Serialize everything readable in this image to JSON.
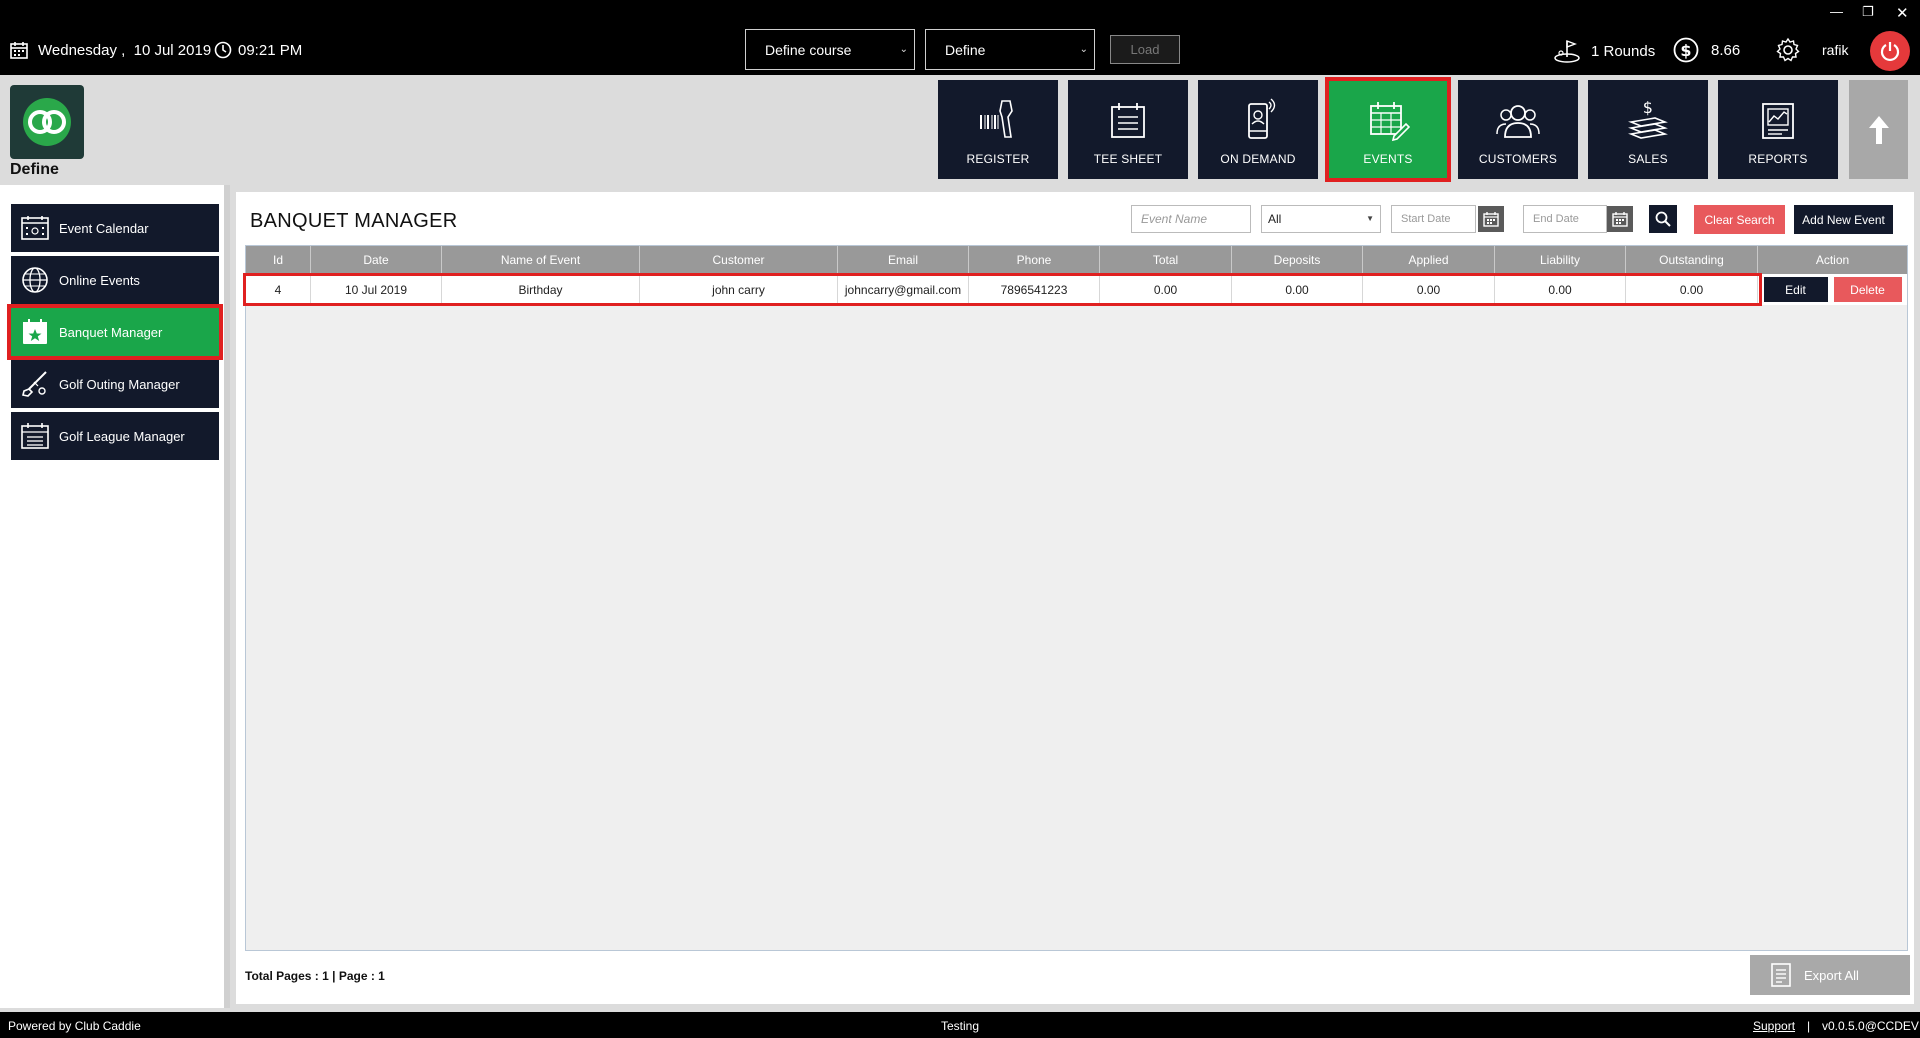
{
  "topbar": {
    "date": "Wednesday ,  10 Jul 2019",
    "time": "09:21 PM",
    "course_select": "Define course",
    "define_select": "Define",
    "load_label": "Load",
    "rounds": "1 Rounds",
    "balance": "8.66",
    "user": "rafik"
  },
  "header": {
    "course_name": "Define",
    "nav": [
      {
        "label": "REGISTER",
        "icon": "barcode-scanner-icon"
      },
      {
        "label": "TEE SHEET",
        "icon": "sheet-icon"
      },
      {
        "label": "ON DEMAND",
        "icon": "mobile-icon"
      },
      {
        "label": "EVENTS",
        "icon": "calendar-edit-icon",
        "active": true
      },
      {
        "label": "CUSTOMERS",
        "icon": "users-icon"
      },
      {
        "label": "SALES",
        "icon": "money-icon"
      },
      {
        "label": "REPORTS",
        "icon": "report-icon"
      }
    ]
  },
  "sidebar": {
    "items": [
      {
        "label": "Event Calendar",
        "icon": "calendar-icon"
      },
      {
        "label": "Online Events",
        "icon": "globe-icon"
      },
      {
        "label": "Banquet Manager",
        "icon": "star-calendar-icon",
        "active": true
      },
      {
        "label": "Golf Outing Manager",
        "icon": "golf-club-icon"
      },
      {
        "label": "Golf League Manager",
        "icon": "calendar-list-icon"
      }
    ]
  },
  "main": {
    "title": "BANQUET MANAGER",
    "filters": {
      "event_name_placeholder": "Event Name",
      "status_value": "All",
      "start_date_placeholder": "Start Date",
      "end_date_placeholder": "End Date",
      "clear_label": "Clear Search",
      "add_label": "Add New Event"
    },
    "table": {
      "columns": [
        "Id",
        "Date",
        "Name of Event",
        "Customer",
        "Email",
        "Phone",
        "Total",
        "Deposits",
        "Applied",
        "Liability",
        "Outstanding",
        "Action"
      ],
      "rows": [
        {
          "cells": [
            "4",
            "10 Jul 2019",
            "Birthday",
            "john carry",
            "johncarry@gmail.com",
            "7896541223",
            "0.00",
            "0.00",
            "0.00",
            "0.00",
            "0.00"
          ],
          "edit_label": "Edit",
          "delete_label": "Delete"
        }
      ]
    },
    "pager": "Total Pages : 1 | Page : 1",
    "export_label": "Export All"
  },
  "footer": {
    "powered": "Powered by Club Caddie",
    "env": "Testing",
    "support": "Support",
    "separator": "|",
    "version": "v0.0.5.0@CCDEV"
  },
  "colors": {
    "dark_navy": "#12192b",
    "active_green": "#1aa64a",
    "highlight_red": "#e02020",
    "danger_red": "#e8595c"
  }
}
